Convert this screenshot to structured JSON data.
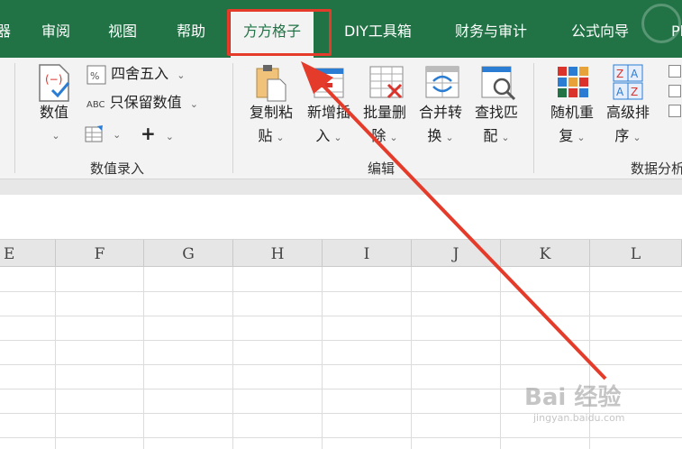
{
  "tabs": [
    "器",
    "审阅",
    "视图",
    "帮助",
    "方方格子",
    "DIY工具箱",
    "财务与审计",
    "公式向导",
    "Pl"
  ],
  "active_tab": "方方格子",
  "ribbon": {
    "group1": {
      "label": "数值录入",
      "value_btn": {
        "line1": "数值",
        "caret": "⌄"
      },
      "round_btn": "四舍五入",
      "keep_value_btn": "只保留数值",
      "keep_value_badge": "ABC",
      "plus_btn": "+"
    },
    "group2": {
      "label": "编辑",
      "buttons": [
        {
          "line1": "复制粘",
          "line2": "贴"
        },
        {
          "line1": "新增插",
          "line2": "入"
        },
        {
          "line1": "批量删",
          "line2": "除"
        },
        {
          "line1": "合并转",
          "line2": "换"
        },
        {
          "line1": "查找匹",
          "line2": "配"
        }
      ]
    },
    "group3": {
      "label": "数据分析",
      "buttons": [
        {
          "line1": "随机重",
          "line2": "复"
        },
        {
          "line1": "高级排",
          "line2": "序"
        }
      ]
    }
  },
  "columns": [
    "E",
    "F",
    "G",
    "H",
    "I",
    "J",
    "K",
    "L"
  ],
  "watermark": {
    "text": "Bai 经验",
    "url": "jingyan.baidu.com"
  },
  "colors": {
    "accent": "#217346",
    "highlight": "#e53b2a"
  }
}
